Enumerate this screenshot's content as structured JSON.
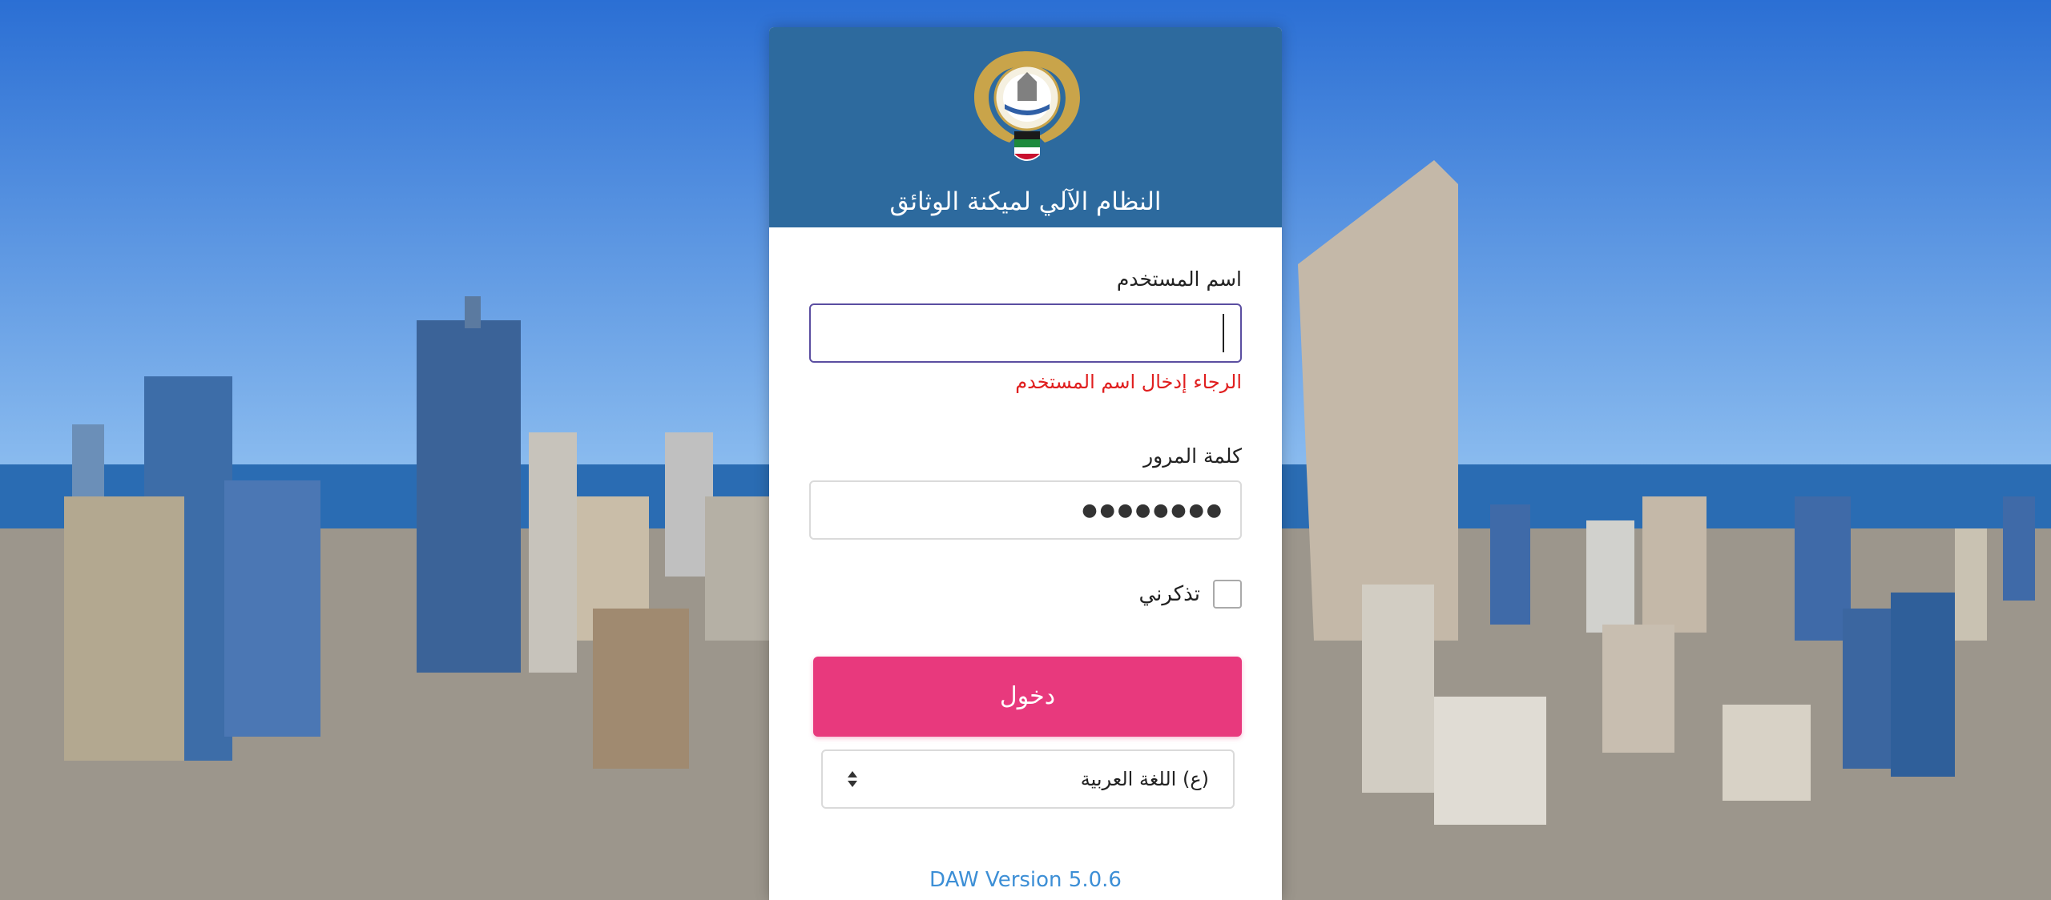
{
  "header": {
    "title": "النظام الآلي لميكنة الوثائق",
    "emblem": "kuwait-emblem"
  },
  "form": {
    "username_label": "اسم المستخدم",
    "username_value": "",
    "username_error": "الرجاء إدخال اسم المستخدم",
    "password_label": "كلمة المرور",
    "password_value": "●●●●●●●●",
    "remember_label": "تذكرني",
    "remember_checked": false,
    "login_label": "دخول",
    "language_selected": "(ع) اللغة العربية"
  },
  "footer": {
    "version": "DAW Version 5.0.6"
  },
  "colors": {
    "header_bg": "#2d6a9e",
    "login_button": "#e8397d",
    "error_text": "#e01e1e",
    "version_link": "#3d8fd6",
    "focus_border": "#5b4ea1"
  }
}
